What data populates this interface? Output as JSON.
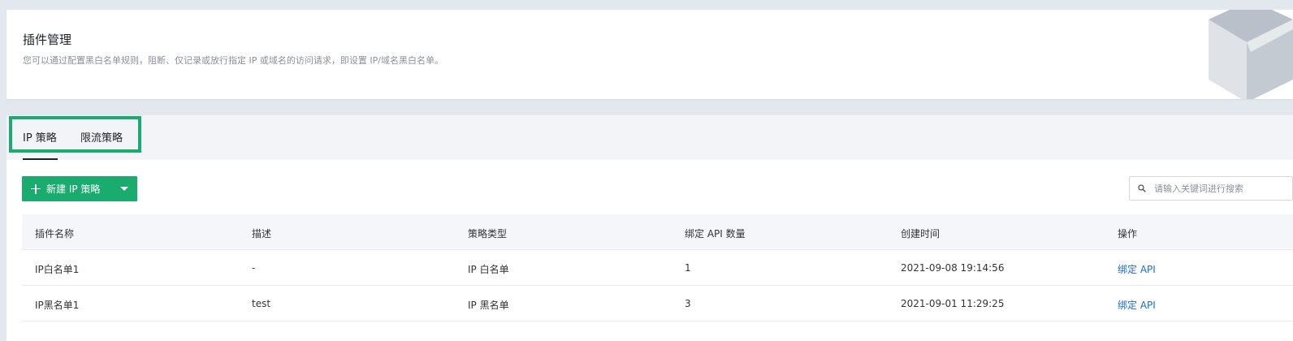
{
  "header": {
    "title": "插件管理",
    "description": "您可以通过配置黑白名单规则，阻断、仅记录或放行指定 IP 或域名的访问请求，即设置 IP/域名黑白名单。"
  },
  "tabs": [
    {
      "label": "IP 策略",
      "active": true
    },
    {
      "label": "限流策略",
      "active": false
    }
  ],
  "toolbar": {
    "new_button_label": "新建 IP 策略",
    "search_placeholder": "请输入关键词进行搜索"
  },
  "table": {
    "columns": [
      "插件名称",
      "描述",
      "策略类型",
      "绑定 API 数量",
      "创建时间",
      "操作"
    ],
    "rows": [
      {
        "name": "IP白名单1",
        "desc": "-",
        "type": "IP 白名单",
        "api_count": "1",
        "created": "2021-09-08 19:14:56",
        "action": "绑定 API"
      },
      {
        "name": "IP黑名单1",
        "desc": "test",
        "type": "IP 黑名单",
        "api_count": "3",
        "created": "2021-09-01 11:29:25",
        "action": "绑定 API"
      }
    ]
  },
  "colors": {
    "accent": "#1aac6f",
    "link": "#1b6bd6",
    "tab_highlight": "#1aac6f"
  }
}
